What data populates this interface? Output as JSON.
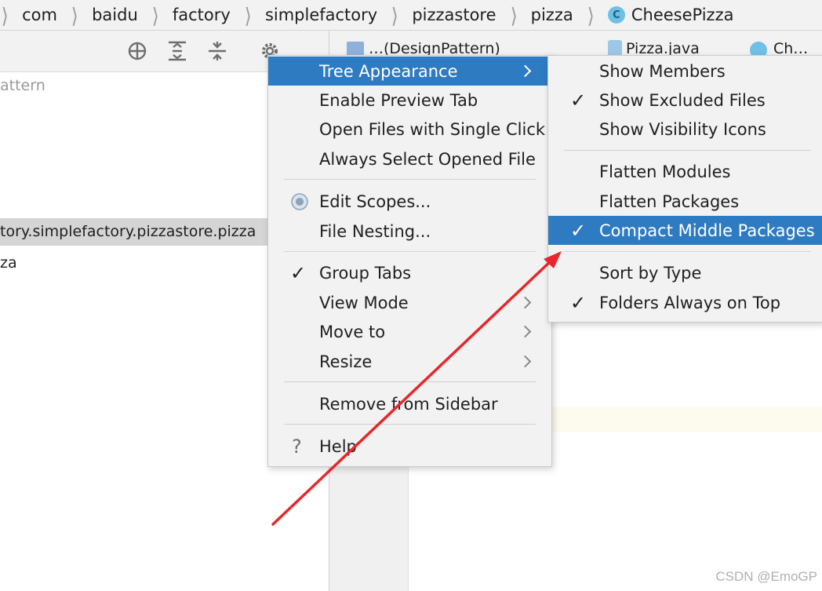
{
  "breadcrumb": {
    "items": [
      "com",
      "baidu",
      "factory",
      "simplefactory",
      "pizzastore",
      "pizza",
      "CheesePizza"
    ],
    "class_icon_letter": "C"
  },
  "project_panel": {
    "rows": [
      "attern",
      "tory.simplefactory.pizzastore.pizza",
      "za"
    ]
  },
  "editor_tabs": [
    "…(DesignPattern)",
    "Pizza.java",
    "Ch…"
  ],
  "context_menu": {
    "items": [
      {
        "label": "Tree Appearance",
        "submenu": true,
        "active": true
      },
      {
        "label": "Enable Preview Tab"
      },
      {
        "label": "Open Files with Single Click"
      },
      {
        "label": "Always Select Opened File"
      },
      {
        "label": "Edit Scopes...",
        "icon": "radio-icon"
      },
      {
        "label": "File Nesting..."
      },
      {
        "label": "Group Tabs",
        "checked": true
      },
      {
        "label": "View Mode",
        "submenu": true
      },
      {
        "label": "Move to",
        "submenu": true
      },
      {
        "label": "Resize",
        "submenu": true
      },
      {
        "label": "Remove from Sidebar"
      },
      {
        "label": "Help",
        "icon": "help-icon"
      }
    ]
  },
  "submenu": {
    "items": [
      {
        "label": "Show Members",
        "checked": false
      },
      {
        "label": "Show Excluded Files",
        "checked": true
      },
      {
        "label": "Show Visibility Icons",
        "checked": false
      },
      {
        "label": "Flatten Modules",
        "checked": false
      },
      {
        "label": "Flatten Packages",
        "checked": false
      },
      {
        "label": "Compact Middle Packages",
        "checked": true,
        "active": true
      },
      {
        "label": "Sort by Type",
        "checked": false
      },
      {
        "label": "Folders Always on Top",
        "checked": true
      }
    ]
  },
  "watermark": "CSDN @EmoGP",
  "colors": {
    "accent": "#2f7bc1",
    "annotation_arrow": "#e8262b"
  }
}
